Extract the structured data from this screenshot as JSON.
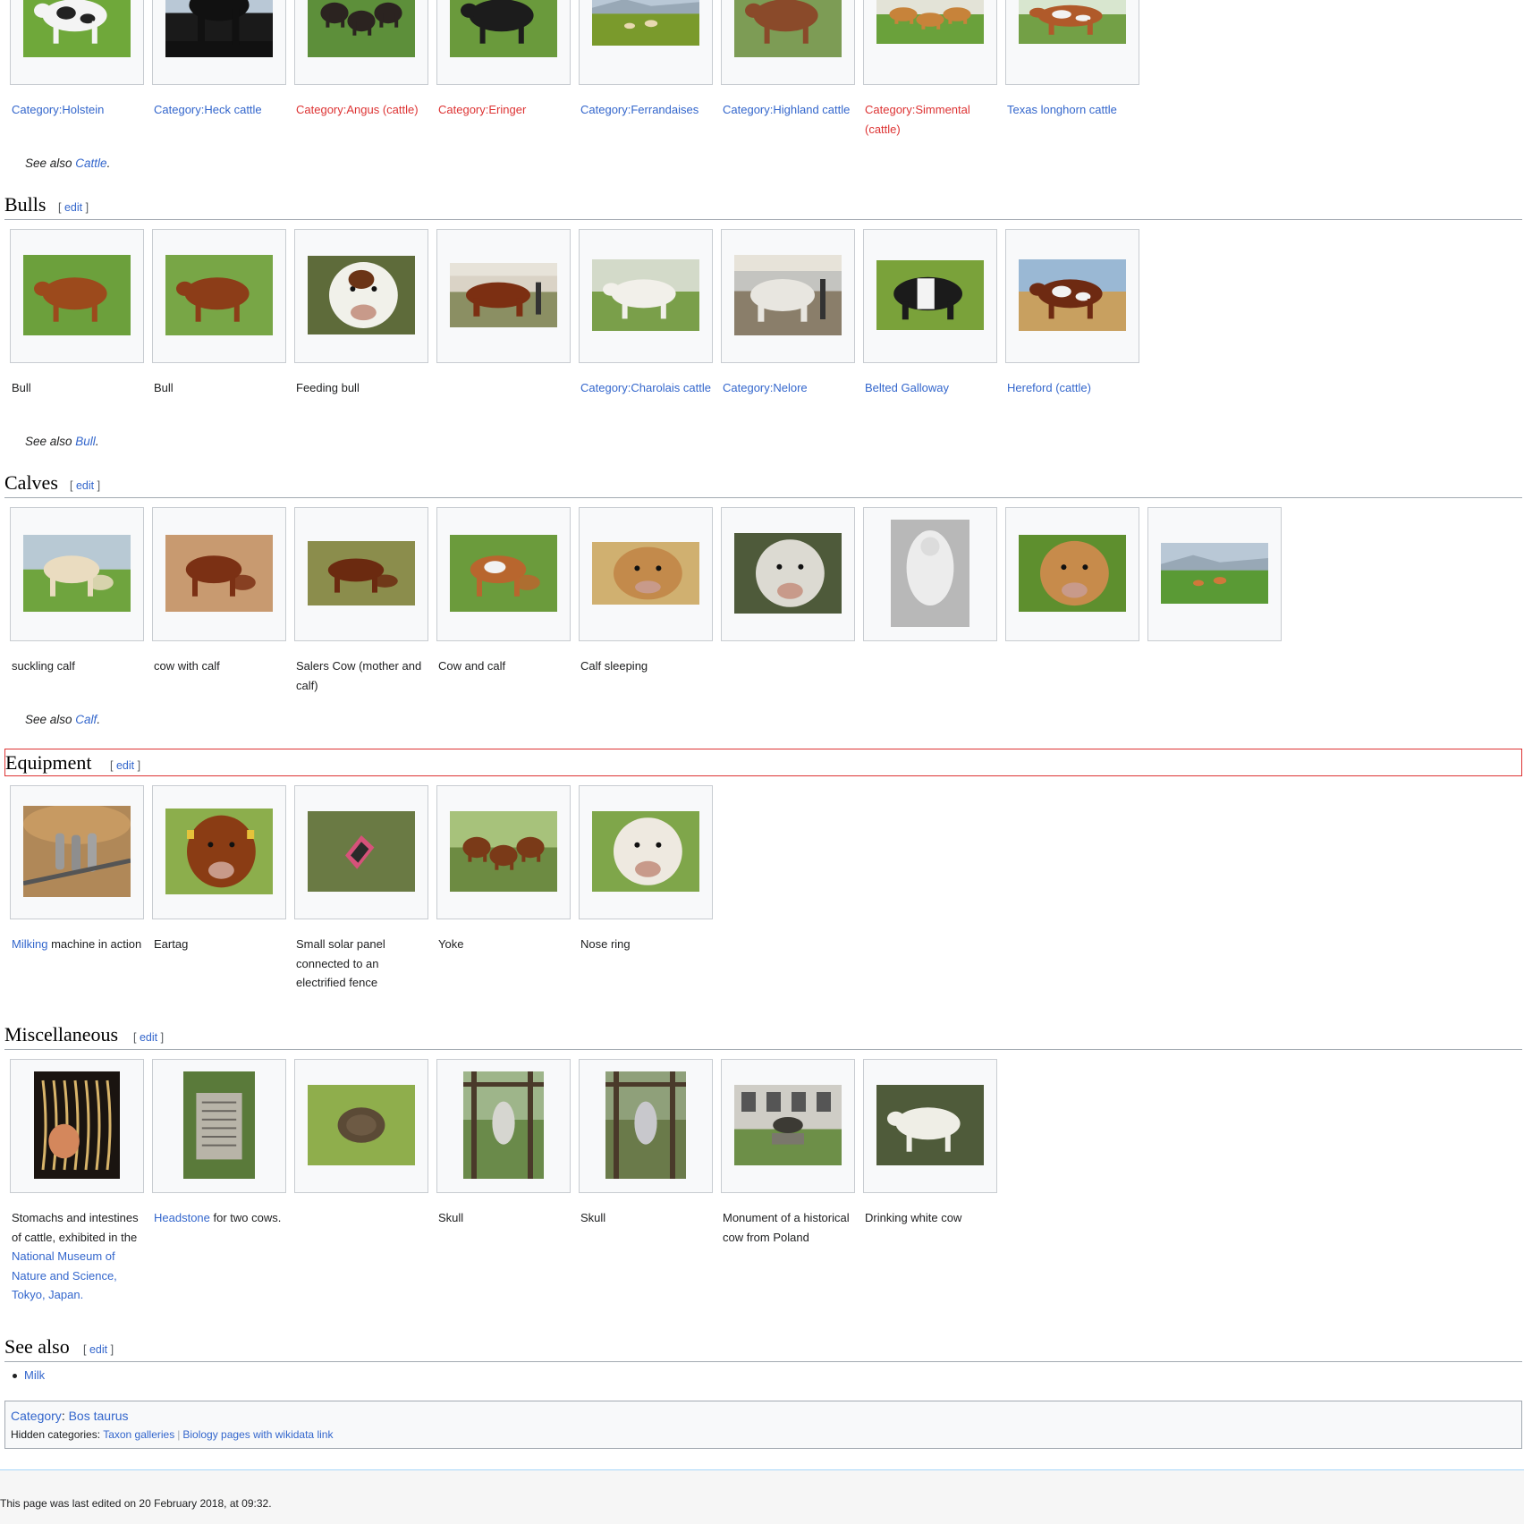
{
  "top_gallery": [
    {
      "caption_parts": [
        {
          "text": "Category:Holstein",
          "link": "blue"
        }
      ],
      "img": "holstein"
    },
    {
      "caption_parts": [
        {
          "text": "Category:Heck cattle",
          "link": "blue"
        }
      ],
      "img": "heck"
    },
    {
      "caption_parts": [
        {
          "text": "Category:Angus (cattle)",
          "link": "red"
        }
      ],
      "img": "angus"
    },
    {
      "caption_parts": [
        {
          "text": "Category:Eringer",
          "link": "red"
        }
      ],
      "img": "eringer"
    },
    {
      "caption_parts": [
        {
          "text": "Category:Ferrandaises",
          "link": "blue"
        }
      ],
      "img": "ferrandaise"
    },
    {
      "caption_parts": [
        {
          "text": "Category:Highland cattle",
          "link": "blue"
        }
      ],
      "img": "highland"
    },
    {
      "caption_parts": [
        {
          "text": "Category:Simmental (cattle)",
          "link": "red"
        }
      ],
      "img": "simmental"
    },
    {
      "caption_parts": [
        {
          "text": "Texas longhorn cattle",
          "link": "blue"
        }
      ],
      "img": "longhorn"
    }
  ],
  "see_also_cattle": {
    "prefix": "See also ",
    "link": "Cattle",
    "suffix": "."
  },
  "sections": {
    "bulls": {
      "title": "Bulls",
      "edit": "edit"
    },
    "calves": {
      "title": "Calves",
      "edit": "edit"
    },
    "equipment": {
      "title": "Equipment",
      "edit": "edit"
    },
    "misc": {
      "title": "Miscellaneous",
      "edit": "edit"
    },
    "see_also": {
      "title": "See also",
      "edit": "edit"
    }
  },
  "bulls_gallery": [
    {
      "caption_parts": [
        {
          "text": "Bull"
        }
      ],
      "img": "bull1"
    },
    {
      "caption_parts": [
        {
          "text": "Bull"
        }
      ],
      "img": "bull2"
    },
    {
      "caption_parts": [
        {
          "text": "Feeding bull"
        }
      ],
      "img": "feeding"
    },
    {
      "caption_parts": [],
      "img": "showbull"
    },
    {
      "caption_parts": [
        {
          "text": "Category:Charolais cattle",
          "link": "blue"
        }
      ],
      "img": "charolais"
    },
    {
      "caption_parts": [
        {
          "text": "Category:Nelore",
          "link": "blue"
        }
      ],
      "img": "nelore"
    },
    {
      "caption_parts": [
        {
          "text": "Belted Galloway",
          "link": "blue"
        }
      ],
      "img": "belted"
    },
    {
      "caption_parts": [
        {
          "text": "Hereford (cattle)",
          "link": "blue"
        }
      ],
      "img": "hereford"
    }
  ],
  "see_also_bull": {
    "prefix": "See also ",
    "link": "Bull",
    "suffix": "."
  },
  "calves_gallery": [
    {
      "caption_parts": [
        {
          "text": "suckling calf"
        }
      ],
      "img": "suckling"
    },
    {
      "caption_parts": [
        {
          "text": "cow with calf"
        }
      ],
      "img": "cowcalf"
    },
    {
      "caption_parts": [
        {
          "text": "Salers Cow (mother and calf)"
        }
      ],
      "img": "salers"
    },
    {
      "caption_parts": [
        {
          "text": "Cow and calf"
        }
      ],
      "img": "cowandcalf"
    },
    {
      "caption_parts": [
        {
          "text": "Calf sleeping"
        }
      ],
      "img": "sleeping"
    },
    {
      "caption_parts": [],
      "img": "brahmancalf"
    },
    {
      "caption_parts": [],
      "img": "bwcalf"
    },
    {
      "caption_parts": [],
      "img": "jerseycalf"
    },
    {
      "caption_parts": [],
      "img": "fieldcalf"
    }
  ],
  "see_also_calf": {
    "prefix": "See also ",
    "link": "Calf",
    "suffix": "."
  },
  "equipment_gallery": [
    {
      "caption_parts": [
        {
          "text": "Milking",
          "link": "blue"
        },
        {
          "text": " machine in action"
        }
      ],
      "img": "milking"
    },
    {
      "caption_parts": [
        {
          "text": "Eartag"
        }
      ],
      "img": "eartag"
    },
    {
      "caption_parts": [
        {
          "text": "Small solar panel connected to an electrified fence"
        }
      ],
      "img": "solar"
    },
    {
      "caption_parts": [
        {
          "text": "Yoke"
        }
      ],
      "img": "yoke"
    },
    {
      "caption_parts": [
        {
          "text": "Nose ring"
        }
      ],
      "img": "nosering"
    }
  ],
  "misc_gallery": [
    {
      "caption_parts": [
        {
          "text": "Stomachs and intestines of cattle, exhibited in the "
        },
        {
          "text": "National Museum of Nature and Science, Tokyo, Japan.",
          "link": "blue"
        }
      ],
      "img": "stomach"
    },
    {
      "caption_parts": [
        {
          "text": "Headstone",
          "link": "blue"
        },
        {
          "text": " for two cows."
        }
      ],
      "img": "headstone"
    },
    {
      "caption_parts": [],
      "img": "dung"
    },
    {
      "caption_parts": [
        {
          "text": "Skull"
        }
      ],
      "img": "skull1"
    },
    {
      "caption_parts": [
        {
          "text": "Skull"
        }
      ],
      "img": "skull2"
    },
    {
      "caption_parts": [
        {
          "text": "Monument of a historical cow from Poland"
        }
      ],
      "img": "monument"
    },
    {
      "caption_parts": [
        {
          "text": "Drinking white cow"
        }
      ],
      "img": "drinking"
    }
  ],
  "see_also_list": [
    "Milk"
  ],
  "catlinks": {
    "label": "Category",
    "colon": ": ",
    "category": "Bos taurus",
    "hidden_label": "Hidden categories: ",
    "hidden": [
      "Taxon galleries",
      "Biology pages with wikidata link"
    ]
  },
  "footer": {
    "last_modified": "This page was last edited on 20 February 2018, at 09:32."
  },
  "colors": {
    "link": "#3366cc",
    "redlink": "#d33",
    "border": "#a2a9b1",
    "thumb_bg": "#f8f9fa",
    "highlight": "#dd3333"
  }
}
